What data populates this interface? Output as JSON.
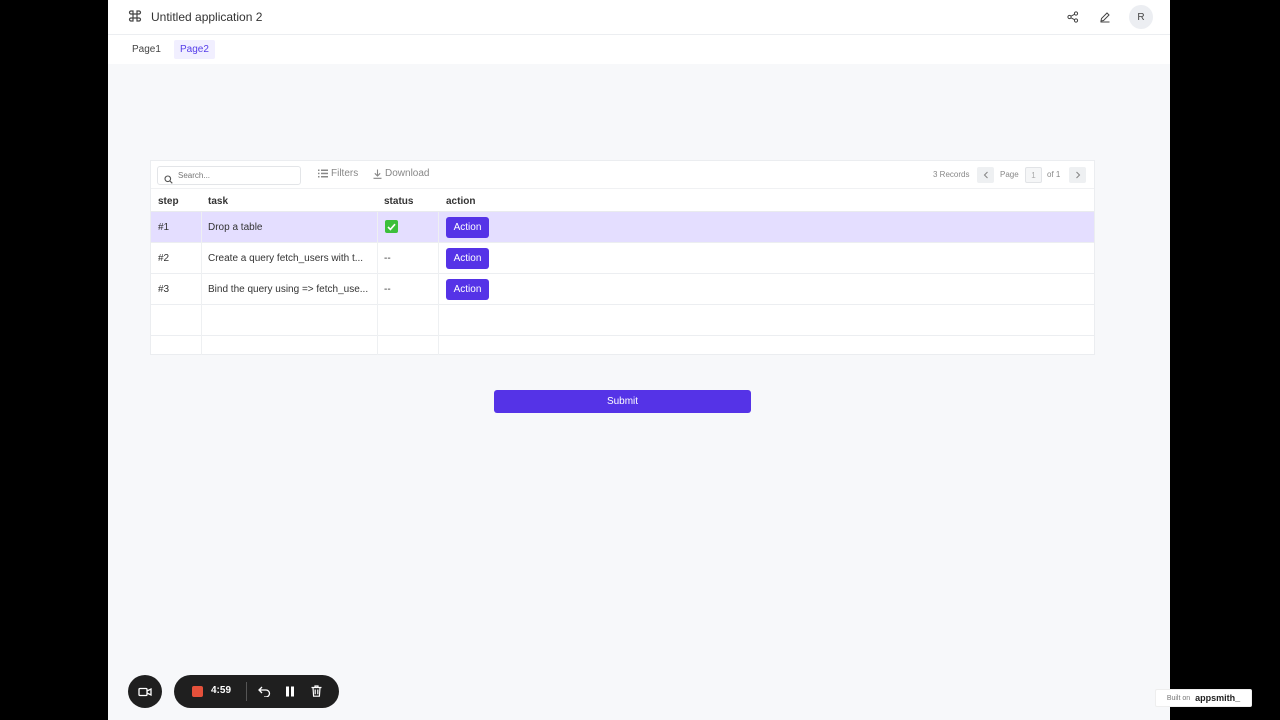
{
  "app": {
    "title": "Untitled application 2",
    "avatar_initial": "R"
  },
  "pages": [
    {
      "label": "Page1",
      "active": false
    },
    {
      "label": "Page2",
      "active": true
    }
  ],
  "table": {
    "search_placeholder": "Search...",
    "filters_label": "Filters",
    "download_label": "Download",
    "records_label": "3 Records",
    "page_label": "Page",
    "current_page": "1",
    "of_label": "of 1",
    "columns": [
      "step",
      "task",
      "status",
      "action"
    ],
    "rows": [
      {
        "step": "#1",
        "task": "Drop a table",
        "status": "check",
        "action": "Action"
      },
      {
        "step": "#2",
        "task": "Create a query fetch_users with t...",
        "status": "--",
        "action": "Action"
      },
      {
        "step": "#3",
        "task": "Bind the query using => fetch_use...",
        "status": "--",
        "action": "Action"
      }
    ]
  },
  "submit_label": "Submit",
  "recorder": {
    "time": "4:59"
  },
  "footer": {
    "built_on": "Built on",
    "brand": "appsmith_"
  },
  "colors": {
    "accent": "#5533e7",
    "selected_row": "#e4deff",
    "record_stop": "#e5513b"
  }
}
